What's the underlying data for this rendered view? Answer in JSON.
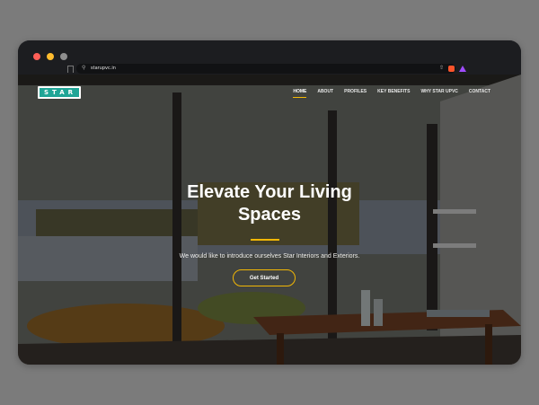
{
  "browser": {
    "url": "starupvc.in"
  },
  "site": {
    "logo_text": "STAR",
    "nav": [
      {
        "label": "HOME",
        "active": true
      },
      {
        "label": "ABOUT",
        "active": false
      },
      {
        "label": "PROFILES",
        "active": false
      },
      {
        "label": "KEY BENEFITS",
        "active": false
      },
      {
        "label": "WHY STAR UPVC",
        "active": false
      },
      {
        "label": "CONTACT",
        "active": false
      }
    ],
    "hero": {
      "title_line1": "Elevate Your Living",
      "title_line2": "Spaces",
      "subtitle": "We would like to introduce ourselves Star Interiors and Exteriors.",
      "cta_label": "Get Started"
    }
  },
  "colors": {
    "accent": "#f2b705",
    "brand": "#1fa596"
  }
}
